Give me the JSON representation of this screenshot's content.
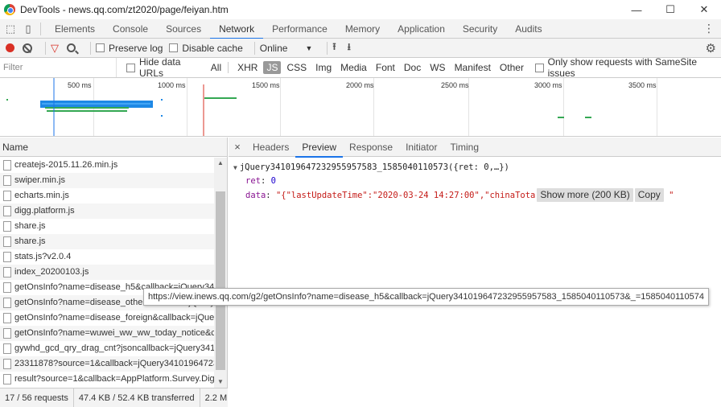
{
  "window": {
    "title": "DevTools - news.qq.com/zt2020/page/feiyan.htm",
    "minimize": "—",
    "maximize": "☐",
    "close": "✕"
  },
  "panels": {
    "tabs": [
      "Elements",
      "Console",
      "Sources",
      "Network",
      "Performance",
      "Memory",
      "Application",
      "Security",
      "Audits"
    ],
    "active": "Network"
  },
  "toolbar": {
    "preserve_log": "Preserve log",
    "disable_cache": "Disable cache",
    "throttle": "Online"
  },
  "filter": {
    "placeholder": "Filter",
    "hide_data_urls": "Hide data URLs",
    "types": [
      "All",
      "XHR",
      "JS",
      "CSS",
      "Img",
      "Media",
      "Font",
      "Doc",
      "WS",
      "Manifest",
      "Other"
    ],
    "active_type": "JS",
    "samesite": "Only show requests with SameSite issues"
  },
  "overview": {
    "ticks": [
      "500 ms",
      "1000 ms",
      "1500 ms",
      "2000 ms",
      "2500 ms",
      "3000 ms",
      "3500 ms"
    ]
  },
  "requests": {
    "header": "Name",
    "rows": [
      "createjs-2015.11.26.min.js",
      "swiper.min.js",
      "echarts.min.js",
      "digg.platform.js",
      "share.js",
      "share.js",
      "stats.js?v2.0.4",
      "index_20200103.js",
      "getOnsInfo?name=disease_h5&callback=jQuery341",
      "getOnsInfo?name=disease_other&callback=jQuery",
      "getOnsInfo?name=disease_foreign&callback=jQuer",
      "getOnsInfo?name=wuwei_ww_ww_today_notice&ca",
      "gywhd_gcd_qry_drag_cnt?jsoncallback=jQuery3410",
      "23311878?source=1&callback=jQuery34101964723",
      "result?source=1&callback=AppPlatform.Survey.Dig"
    ],
    "status": [
      "17 / 56 requests",
      "47.4 KB / 52.4 KB transferred",
      "2.2 M"
    ]
  },
  "detail": {
    "close": "×",
    "tabs": [
      "Headers",
      "Preview",
      "Response",
      "Initiator",
      "Timing"
    ],
    "active": "Preview",
    "root": "jQuery341019647232955957583_1585040110573({ret: 0,…})",
    "ret_key": "ret",
    "ret_value": "0",
    "data_key": "data",
    "data_value": "\"{\"lastUpdateTime\":\"2020-03-24 14:27:00\",\"chinaTota",
    "show_more": "Show more (200 KB)",
    "copy": "Copy",
    "trailing_quote": "\""
  },
  "tooltip": "https://view.inews.qq.com/g2/getOnsInfo?name=disease_h5&callback=jQuery341019647232955957583_1585040110573&_=1585040110574"
}
